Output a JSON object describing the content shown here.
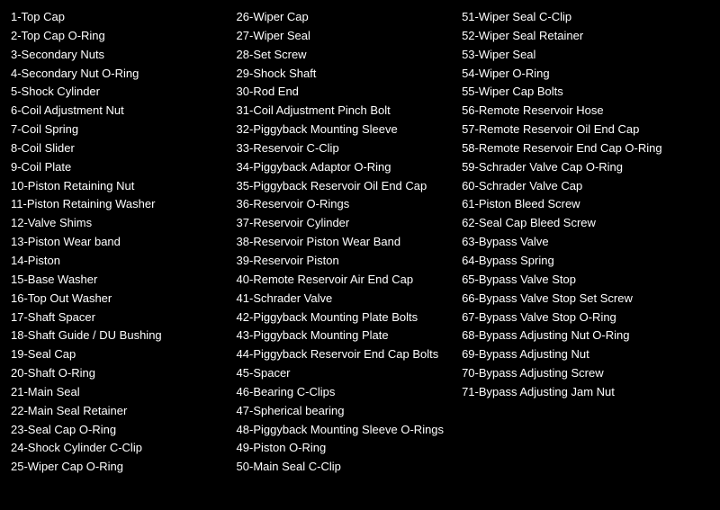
{
  "col1": [
    "1-Top Cap",
    "2-Top Cap O-Ring",
    "3-Secondary Nuts",
    "4-Secondary Nut O-Ring",
    "5-Shock Cylinder",
    "6-Coil Adjustment Nut",
    "7-Coil Spring",
    "8-Coil Slider",
    "9-Coil Plate",
    "10-Piston Retaining Nut",
    "11-Piston Retaining Washer",
    "12-Valve Shims",
    "13-Piston Wear band",
    "14-Piston",
    "15-Base Washer",
    "16-Top Out Washer",
    "17-Shaft Spacer",
    "18-Shaft Guide / DU Bushing",
    "19-Seal Cap",
    "20-Shaft O-Ring",
    "21-Main Seal",
    "22-Main Seal Retainer",
    "23-Seal Cap O-Ring",
    "24-Shock Cylinder C-Clip",
    "25-Wiper Cap O-Ring"
  ],
  "col2": [
    "26-Wiper Cap",
    "27-Wiper Seal",
    "28-Set Screw",
    "29-Shock Shaft",
    "30-Rod End",
    "31-Coil Adjustment Pinch Bolt",
    "32-Piggyback Mounting Sleeve",
    "33-Reservoir C-Clip",
    "34-Piggyback Adaptor O-Ring",
    "35-Piggyback Reservoir Oil End Cap",
    "36-Reservoir O-Rings",
    "37-Reservoir Cylinder",
    "38-Reservoir Piston Wear Band",
    "39-Reservoir Piston",
    "40-Remote Reservoir Air End Cap",
    "41-Schrader Valve",
    "42-Piggyback Mounting Plate Bolts",
    "43-Piggyback Mounting Plate",
    "44-Piggyback Reservoir End Cap Bolts",
    "45-Spacer",
    "46-Bearing C-Clips",
    "47-Spherical bearing",
    "48-Piggyback Mounting Sleeve O-Rings",
    "49-Piston O-Ring",
    "50-Main Seal C-Clip"
  ],
  "col3": [
    "51-Wiper Seal C-Clip",
    "52-Wiper Seal Retainer",
    "53-Wiper Seal",
    "54-Wiper O-Ring",
    "55-Wiper Cap Bolts",
    "56-Remote Reservoir Hose",
    "57-Remote Reservoir Oil End Cap",
    "58-Remote Reservoir End Cap O-Ring",
    "59-Schrader Valve Cap O-Ring",
    "60-Schrader Valve Cap",
    "61-Piston Bleed Screw",
    "62-Seal Cap Bleed Screw",
    "63-Bypass Valve",
    "64-Bypass Spring",
    "65-Bypass Valve Stop",
    "66-Bypass Valve Stop Set Screw",
    "67-Bypass Valve Stop O-Ring",
    "68-Bypass Adjusting Nut O-Ring",
    "69-Bypass Adjusting Nut",
    "70-Bypass Adjusting Screw",
    "71-Bypass Adjusting Jam Nut"
  ]
}
